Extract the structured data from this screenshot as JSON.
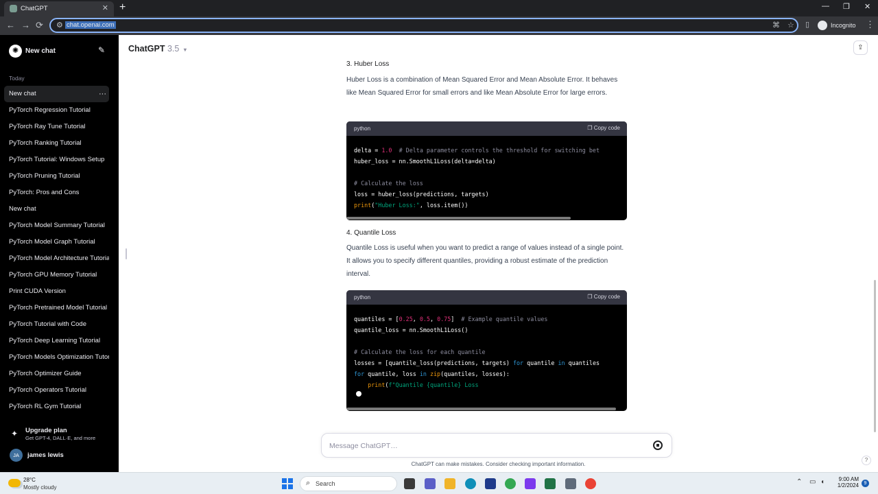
{
  "browser": {
    "tab_title": "ChatGPT",
    "tab_close": "✕",
    "new_tab": "+",
    "url": "chat.openai.com",
    "profile_label": "Incognito",
    "back": "←",
    "forward": "→",
    "reload": "⟳",
    "minimize": "—",
    "maximize": "❐",
    "close": "✕",
    "menu": "⋮"
  },
  "sidebar": {
    "new_chat_label": "New chat",
    "section_label": "Today",
    "chats": [
      {
        "label": "New chat",
        "active": true
      },
      {
        "label": "PyTorch Regression Tutorial"
      },
      {
        "label": "PyTorch Ray Tune Tutorial"
      },
      {
        "label": "PyTorch Ranking Tutorial"
      },
      {
        "label": "PyTorch Tutorial: Windows Setup"
      },
      {
        "label": "PyTorch Pruning Tutorial"
      },
      {
        "label": "PyTorch: Pros and Cons"
      },
      {
        "label": "New chat"
      },
      {
        "label": "PyTorch Model Summary Tutorial"
      },
      {
        "label": "PyTorch Model Graph Tutorial"
      },
      {
        "label": "PyTorch Model Architecture Tutorial"
      },
      {
        "label": "PyTorch GPU Memory Tutorial"
      },
      {
        "label": "Print CUDA Version"
      },
      {
        "label": "PyTorch Pretrained Model Tutorial"
      },
      {
        "label": "PyTorch Tutorial with Code"
      },
      {
        "label": "PyTorch Deep Learning Tutorial"
      },
      {
        "label": "PyTorch Models Optimization Tutorial"
      },
      {
        "label": "PyTorch Optimizer Guide"
      },
      {
        "label": "PyTorch Operators Tutorial"
      },
      {
        "label": "PyTorch RL Gym Tutorial"
      }
    ],
    "chat_more": "···",
    "upgrade_title": "Upgrade plan",
    "upgrade_subtitle": "Get GPT-4, DALL·E, and more",
    "user_initials": "JA",
    "user_name": "james lewis"
  },
  "header": {
    "model_name": "ChatGPT",
    "model_version": "3.5"
  },
  "content": {
    "huber_heading": "3. Huber Loss",
    "huber_para": "Huber Loss is a combination of Mean Squared Error and Mean Absolute Error. It behaves like Mean Squared Error for small errors and like Mean Absolute Error for large errors.",
    "code1": {
      "lang": "python",
      "copy": "Copy code",
      "lines": [
        [
          {
            "t": "delta = ",
            "c": ""
          },
          {
            "t": "1.0",
            "c": "num"
          },
          {
            "t": "  # Delta parameter controls the threshold for switching bet",
            "c": "cm"
          }
        ],
        [
          {
            "t": "huber_loss = nn.SmoothL1Loss(delta=delta)",
            "c": ""
          }
        ],
        [
          {
            "t": "",
            "c": ""
          }
        ],
        [
          {
            "t": "# Calculate the loss",
            "c": "cm"
          }
        ],
        [
          {
            "t": "loss = huber_loss(predictions, targets)",
            "c": ""
          }
        ],
        [
          {
            "t": "print",
            "c": "fn"
          },
          {
            "t": "(",
            "c": ""
          },
          {
            "t": "\"Huber Loss:\"",
            "c": "str"
          },
          {
            "t": ", loss.item())",
            "c": ""
          }
        ]
      ]
    },
    "quantile_heading": "4. Quantile Loss",
    "quantile_para": "Quantile Loss is useful when you want to predict a range of values instead of a single point. It allows you to specify different quantiles, providing a robust estimate of the prediction interval.",
    "code2": {
      "lang": "python",
      "copy": "Copy code",
      "lines": [
        [
          {
            "t": "quantiles = [",
            "c": ""
          },
          {
            "t": "0.25",
            "c": "num"
          },
          {
            "t": ", ",
            "c": ""
          },
          {
            "t": "0.5",
            "c": "num"
          },
          {
            "t": ", ",
            "c": ""
          },
          {
            "t": "0.75",
            "c": "num"
          },
          {
            "t": "]  ",
            "c": ""
          },
          {
            "t": "# Example quantile values",
            "c": "cm"
          }
        ],
        [
          {
            "t": "quantile_loss = nn.SmoothL1Loss()",
            "c": ""
          }
        ],
        [
          {
            "t": "",
            "c": ""
          }
        ],
        [
          {
            "t": "# Calculate the loss for each quantile",
            "c": "cm"
          }
        ],
        [
          {
            "t": "losses = [quantile_loss(predictions, targets) ",
            "c": ""
          },
          {
            "t": "for",
            "c": "kw"
          },
          {
            "t": " quantile ",
            "c": ""
          },
          {
            "t": "in",
            "c": "kw"
          },
          {
            "t": " quantiles",
            "c": ""
          }
        ],
        [
          {
            "t": "for",
            "c": "kw"
          },
          {
            "t": " quantile, loss ",
            "c": ""
          },
          {
            "t": "in",
            "c": "kw"
          },
          {
            "t": " ",
            "c": ""
          },
          {
            "t": "zip",
            "c": "fn"
          },
          {
            "t": "(quantiles, losses):",
            "c": ""
          }
        ],
        [
          {
            "t": "    ",
            "c": ""
          },
          {
            "t": "print",
            "c": "fn"
          },
          {
            "t": "(",
            "c": ""
          },
          {
            "t": "f\"Quantile {quantile} Loss",
            "c": "str"
          }
        ]
      ]
    }
  },
  "composer": {
    "placeholder": "Message ChatGPT…",
    "disclaimer": "ChatGPT can make mistakes. Consider checking important information."
  },
  "taskbar": {
    "temp": "28°C",
    "weather": "Mostly cloudy",
    "search_label": "Search",
    "time": "9:00 AM",
    "date": "1/2/2024",
    "notif_count": "9"
  },
  "colors": {
    "sidebar_bg": "#000000",
    "code_bg": "#000000",
    "accent_focus": "#8ab4f8"
  }
}
